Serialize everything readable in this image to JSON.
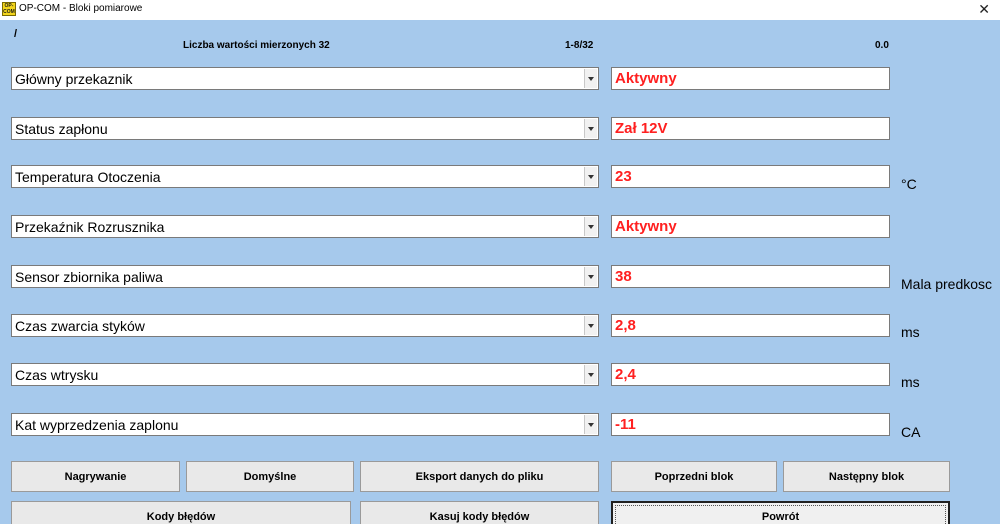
{
  "window": {
    "icon_text": "OP-COM",
    "title": "OP-COM - Bloki pomiarowe",
    "close_glyph": "✕"
  },
  "header": {
    "slash": "/",
    "values_count": "Liczba wartości mierzonych 32",
    "range": "1-8/32",
    "time": "0.0"
  },
  "rows": [
    {
      "name": "Główny przekaznik",
      "value": "Aktywny",
      "unit": ""
    },
    {
      "name": "Status zapłonu",
      "value": "Zał 12V",
      "unit": ""
    },
    {
      "name": "Temperatura Otoczenia",
      "value": "23",
      "unit": "°C"
    },
    {
      "name": "Przekaźnik Rozrusznika",
      "value": "Aktywny",
      "unit": ""
    },
    {
      "name": "Sensor zbiornika paliwa",
      "value": "38",
      "unit": "Mala predkosc"
    },
    {
      "name": "Czas zwarcia styków",
      "value": "2,8",
      "unit": "ms"
    },
    {
      "name": "Czas wtrysku",
      "value": "2,4",
      "unit": "ms"
    },
    {
      "name": "Kat wyprzedzenia zaplonu",
      "value": "-11",
      "unit": "CA"
    }
  ],
  "buttons": {
    "record": "Nagrywanie",
    "defaults": "Domyślne",
    "export": "Eksport danych do pliku",
    "prev_block": "Poprzedni blok",
    "next_block": "Następny blok",
    "fault_codes": "Kody błędów",
    "clear_codes": "Kasuj kody błędów",
    "back": "Powrót"
  },
  "colors": {
    "background": "#a6c9ec",
    "value_text": "#ff2020"
  }
}
